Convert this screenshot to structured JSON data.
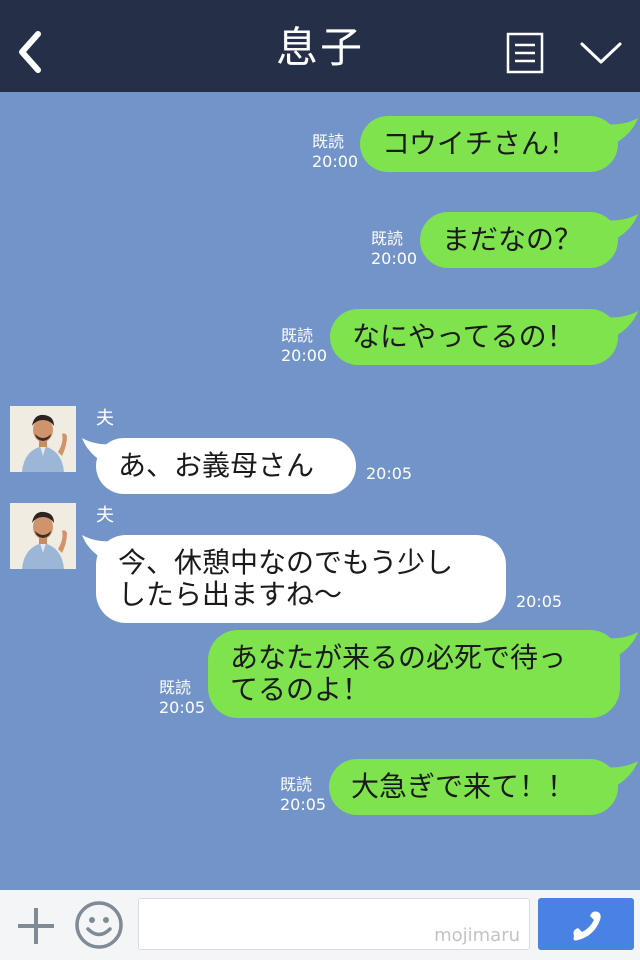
{
  "header": {
    "title": "息子",
    "back_icon": "chevron-left-icon",
    "menu_icon": "menu-list-icon",
    "collapse_icon": "chevron-down-icon",
    "background": "#252f48"
  },
  "chat": {
    "background": "#7394c8",
    "sent_color": "#7fe34e",
    "received_color": "#ffffff",
    "messages": [
      {
        "direction": "sent",
        "text": "コウイチさん！",
        "read": "既読",
        "time": "20:00"
      },
      {
        "direction": "sent",
        "text": "まだなの？",
        "read": "既読",
        "time": "20:00"
      },
      {
        "direction": "sent",
        "text": "なにやってるの！",
        "read": "既読",
        "time": "20:00"
      },
      {
        "direction": "received",
        "sender": "夫",
        "text": "あ、お義母さん",
        "time": "20:05"
      },
      {
        "direction": "received",
        "sender": "夫",
        "text_lines": [
          "今、休憩中なのでもう少し",
          "したら出ますね～"
        ],
        "time": "20:05"
      },
      {
        "direction": "sent",
        "text_lines": [
          "あなたが来るの必死で待っ",
          "てるのよ！"
        ],
        "read": "既読",
        "time": "20:05"
      },
      {
        "direction": "sent",
        "text": "大急ぎで来て！！",
        "read": "既読",
        "time": "20:05"
      }
    ]
  },
  "input_bar": {
    "plus_icon": "plus-icon",
    "emoji_icon": "emoji-smile-icon",
    "input_value": "",
    "watermark": "mojimaru",
    "call_icon": "phone-icon",
    "call_color": "#4a82e4"
  }
}
